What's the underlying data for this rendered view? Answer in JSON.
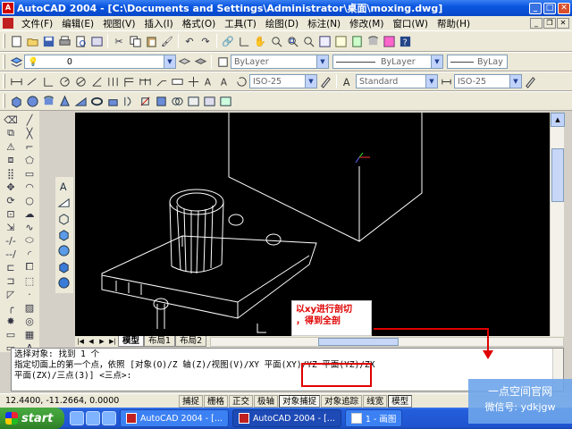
{
  "window": {
    "title": "AutoCAD 2004 - [C:\\Documents and Settings\\Administrator\\桌面\\moxing.dwg]"
  },
  "menu": {
    "items": [
      "文件(F)",
      "编辑(E)",
      "视图(V)",
      "插入(I)",
      "格式(O)",
      "工具(T)",
      "绘图(D)",
      "标注(N)",
      "修改(M)",
      "窗口(W)",
      "帮助(H)"
    ]
  },
  "toolbar": {
    "layer_value": "0",
    "color_value": "ByLayer",
    "linetype_value": "ByLayer",
    "lineweight_value": "ByLay",
    "dimstyle_value": "ISO-25",
    "textstyle_value": "Standard",
    "tablestyle_value": "ISO-25"
  },
  "layout_tabs": {
    "tabs": [
      "模型",
      "布局1",
      "布局2"
    ],
    "active": "模型"
  },
  "command": {
    "lines": [
      "选择对象: 找到 1 个",
      "指定切面上的第一个点，依照 [对象(O)/Z 轴(Z)/视图(V)/XY 平面(XY)/YZ 平面(YZ)/ZX",
      "平面(ZX)/三点(3)] <三点>:"
    ]
  },
  "annotation": {
    "line1": "以xy进行剖切",
    "line2": "，得到全剖"
  },
  "status": {
    "coordinates": "12.4400,  -11.2664, 0.0000",
    "buttons": [
      "捕捉",
      "栅格",
      "正交",
      "极轴",
      "对象捕捉",
      "对象追踪",
      "线宽",
      "模型"
    ],
    "on_buttons": [
      "对象捕捉",
      "模型"
    ]
  },
  "taskbar": {
    "start_label": "start",
    "tasks": [
      "AutoCAD 2004 - [...",
      "AutoCAD 2004 - [...",
      "1 - 画图"
    ]
  },
  "watermark": {
    "line1": "一点空间官网",
    "line2": "微信号: ydkjgw"
  }
}
